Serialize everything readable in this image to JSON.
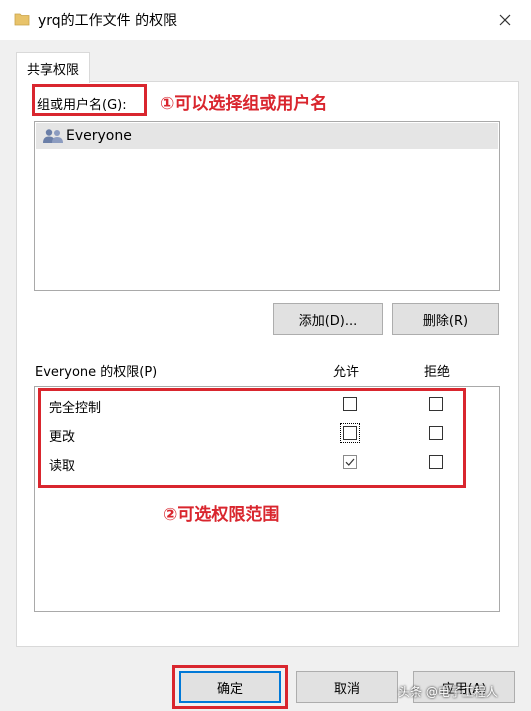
{
  "window": {
    "title": "yrq的工作文件 的权限",
    "close_label": "✕"
  },
  "tabs": [
    {
      "label": "共享权限"
    }
  ],
  "groups": {
    "label": "组或用户名(G):",
    "items": [
      {
        "name": "Everyone",
        "icon": "users-icon",
        "selected": true
      }
    ],
    "add_label": "添加(D)...",
    "remove_label": "删除(R)"
  },
  "permissions": {
    "header_label": "Everyone 的权限(P)",
    "allow_label": "允许",
    "deny_label": "拒绝",
    "rows": [
      {
        "name": "完全控制",
        "allow": false,
        "deny": false
      },
      {
        "name": "更改",
        "allow": false,
        "deny": false
      },
      {
        "name": "读取",
        "allow": true,
        "deny": false
      }
    ]
  },
  "footer": {
    "ok_label": "确定",
    "cancel_label": "取消",
    "apply_label": "应用(A)"
  },
  "annotations": {
    "note1": "①可以选择组或用户名",
    "note2": "②可选权限范围",
    "color": "#d9262e"
  },
  "watermark": "头条 @电子工程人"
}
